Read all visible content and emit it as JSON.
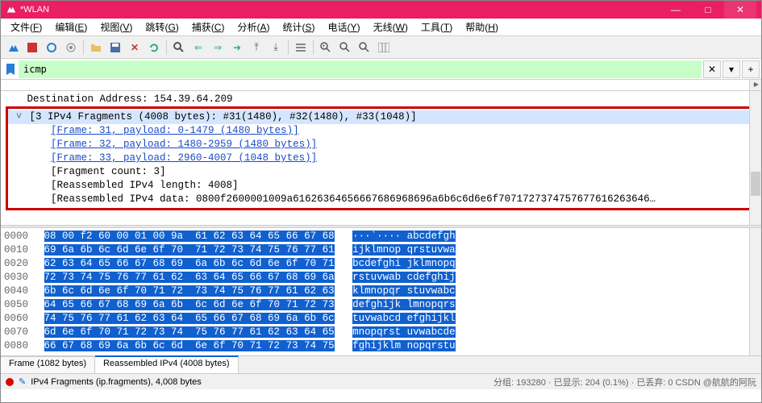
{
  "window": {
    "title": "*WLAN",
    "min": "—",
    "max": "□",
    "close": "✕"
  },
  "menubar": [
    {
      "label": "文件",
      "key": "F"
    },
    {
      "label": "编辑",
      "key": "E"
    },
    {
      "label": "视图",
      "key": "V"
    },
    {
      "label": "跳转",
      "key": "G"
    },
    {
      "label": "捕获",
      "key": "C"
    },
    {
      "label": "分析",
      "key": "A"
    },
    {
      "label": "统计",
      "key": "S"
    },
    {
      "label": "电话",
      "key": "Y"
    },
    {
      "label": "无线",
      "key": "W"
    },
    {
      "label": "工具",
      "key": "T"
    },
    {
      "label": "帮助",
      "key": "H"
    }
  ],
  "filter": {
    "value": "icmp",
    "clear": "✕",
    "dropdown": "▾",
    "add": "+"
  },
  "detail": {
    "dest_line": "   Destination Address: 154.39.64.209",
    "frag_header": "[3 IPv4 Fragments (4008 bytes): #31(1480), #32(1480), #33(1048)]",
    "frames": [
      "[Frame: 31, payload: 0-1479 (1480 bytes)]",
      "[Frame: 32, payload: 1480-2959 (1480 bytes)]",
      "[Frame: 33, payload: 2960-4007 (1048 bytes)]"
    ],
    "frag_count": "[Fragment count: 3]",
    "reasm_len": "[Reassembled IPv4 length: 4008]",
    "reasm_data": "[Reassembled IPv4 data: 0800f2600001009a61626364656667686968696a6b6c6d6e6f7071727374757677616263646…"
  },
  "hex": [
    {
      "off": "0000",
      "b": "08 00 f2 60 00 01 00 9a  61 62 63 64 65 66 67 68",
      "a": "···`···· abcdefgh"
    },
    {
      "off": "0010",
      "b": "69 6a 6b 6c 6d 6e 6f 70  71 72 73 74 75 76 77 61",
      "a": "ijklmnop qrstuvwa"
    },
    {
      "off": "0020",
      "b": "62 63 64 65 66 67 68 69  6a 6b 6c 6d 6e 6f 70 71",
      "a": "bcdefghi jklmnopq"
    },
    {
      "off": "0030",
      "b": "72 73 74 75 76 77 61 62  63 64 65 66 67 68 69 6a",
      "a": "rstuvwab cdefghij"
    },
    {
      "off": "0040",
      "b": "6b 6c 6d 6e 6f 70 71 72  73 74 75 76 77 61 62 63",
      "a": "klmnopqr stuvwabc"
    },
    {
      "off": "0050",
      "b": "64 65 66 67 68 69 6a 6b  6c 6d 6e 6f 70 71 72 73",
      "a": "defghijk lmnopqrs"
    },
    {
      "off": "0060",
      "b": "74 75 76 77 61 62 63 64  65 66 67 68 69 6a 6b 6c",
      "a": "tuvwabcd efghijkl"
    },
    {
      "off": "0070",
      "b": "6d 6e 6f 70 71 72 73 74  75 76 77 61 62 63 64 65",
      "a": "mnopqrst uvwabcde"
    },
    {
      "off": "0080",
      "b": "66 67 68 69 6a 6b 6c 6d  6e 6f 70 71 72 73 74 75",
      "a": "fghijklm nopqrstu"
    }
  ],
  "bottom_tabs": {
    "frame": "Frame (1082 bytes)",
    "reasm": "Reassembled IPv4 (4008 bytes)"
  },
  "statusbar": {
    "left": "IPv4 Fragments (ip.fragments), 4,008 bytes",
    "right": "分组: 193280 · 已显示: 204 (0.1%) · 已丢弃: 0  CSDN @航航的阿阮"
  }
}
